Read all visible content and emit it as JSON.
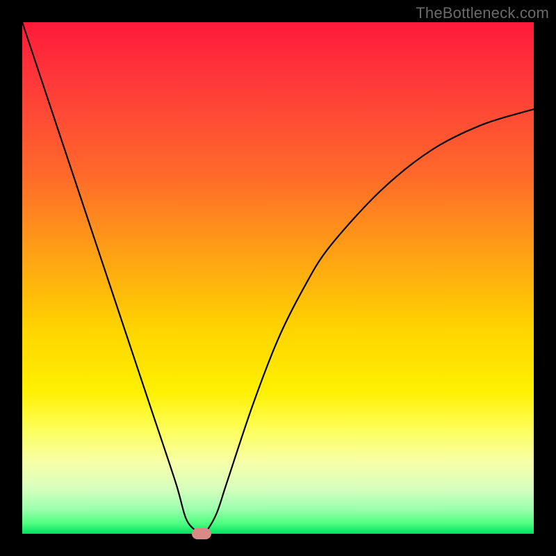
{
  "attribution": "TheBottleneck.com",
  "chart_data": {
    "type": "line",
    "title": "",
    "xlabel": "",
    "ylabel": "",
    "xlim": [
      0,
      100
    ],
    "ylim": [
      0,
      100
    ],
    "grid": false,
    "legend": false,
    "gradient_stops": [
      {
        "pos": 0,
        "color": "#ff1a3a"
      },
      {
        "pos": 30,
        "color": "#ff6a2a"
      },
      {
        "pos": 60,
        "color": "#ffd400"
      },
      {
        "pos": 80,
        "color": "#fdff5e"
      },
      {
        "pos": 100,
        "color": "#00e060"
      }
    ],
    "series": [
      {
        "name": "curve",
        "x": [
          0,
          5,
          10,
          15,
          20,
          25,
          30,
          32,
          34,
          35,
          36,
          38,
          40,
          45,
          50,
          55,
          60,
          70,
          80,
          90,
          100
        ],
        "y": [
          100,
          85,
          70,
          55,
          40,
          25,
          10,
          3,
          0.5,
          0,
          0.5,
          4,
          10,
          25,
          38,
          48,
          56,
          67,
          75,
          80,
          83
        ]
      }
    ],
    "marker": {
      "x": 35,
      "y": 0,
      "color": "#d98a85"
    }
  }
}
